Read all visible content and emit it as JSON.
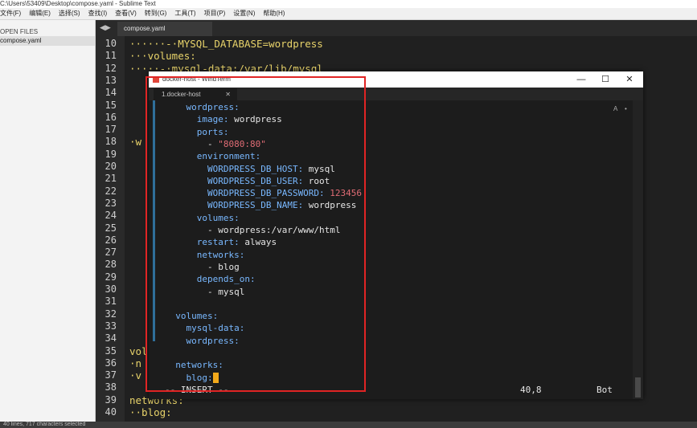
{
  "window": {
    "title": "C:\\Users\\53409\\Desktop\\compose.yaml - Sublime Text"
  },
  "menu": [
    "文件(F)",
    "编辑(E)",
    "选择(S)",
    "查找(I)",
    "查看(V)",
    "转到(G)",
    "工具(T)",
    "项目(P)",
    "设置(N)",
    "帮助(H)"
  ],
  "sidebar": {
    "header": "OPEN FILES",
    "files": [
      "compose.yaml"
    ]
  },
  "editor": {
    "tab": "compose.yaml",
    "line_numbers": [
      "10",
      "11",
      "12",
      "13",
      "14",
      "15",
      "16",
      "17",
      "18",
      "19",
      "20",
      "21",
      "22",
      "23",
      "24",
      "25",
      "26",
      "27",
      "28",
      "29",
      "30",
      "31",
      "32",
      "33",
      "34",
      "35",
      "36",
      "37",
      "38",
      "39",
      "40"
    ],
    "lines": [
      "······-·MYSQL_DATABASE=wordpress",
      "···volumes:",
      "·····-·mysql-data:/var/lib/mysql",
      "",
      "",
      "",
      "",
      "",
      "·w",
      "",
      "",
      "",
      "",
      "",
      "",
      "",
      "",
      "",
      "",
      "",
      "",
      "",
      "",
      "",
      "",
      "vol",
      "·n",
      "·v",
      "",
      "networks:",
      "··blog:"
    ],
    "status": "40 lines, 717 characters selected"
  },
  "windterm": {
    "title": "docker-host - WindTerm",
    "tab": "1.docker-host",
    "tab_close": "✕",
    "tab_right": [
      "A",
      "•",
      "⋮"
    ],
    "buttons": {
      "minimize": "—",
      "maximize": "☐",
      "close": "✕"
    },
    "lines": [
      [
        {
          "t": "    wordpress:",
          "c": "k"
        }
      ],
      [
        {
          "t": "      image:",
          "c": "k"
        },
        {
          "t": " wordpress",
          "c": "v"
        }
      ],
      [
        {
          "t": "      ports:",
          "c": "k"
        }
      ],
      [
        {
          "t": "        - ",
          "c": "v"
        },
        {
          "t": "\"8080:80\"",
          "c": "s"
        }
      ],
      [
        {
          "t": "      environment:",
          "c": "k"
        }
      ],
      [
        {
          "t": "        WORDPRESS_DB_HOST:",
          "c": "k"
        },
        {
          "t": " mysql",
          "c": "v"
        }
      ],
      [
        {
          "t": "        WORDPRESS_DB_USER:",
          "c": "k"
        },
        {
          "t": " root",
          "c": "v"
        }
      ],
      [
        {
          "t": "        WORDPRESS_DB_PASSWORD:",
          "c": "k"
        },
        {
          "t": " 123456",
          "c": "n"
        }
      ],
      [
        {
          "t": "        WORDPRESS_DB_NAME:",
          "c": "k"
        },
        {
          "t": " wordpress",
          "c": "v"
        }
      ],
      [
        {
          "t": "      volumes:",
          "c": "k"
        }
      ],
      [
        {
          "t": "        - wordpress:/var/www/html",
          "c": "v"
        }
      ],
      [
        {
          "t": "      restart:",
          "c": "k"
        },
        {
          "t": " always",
          "c": "v"
        }
      ],
      [
        {
          "t": "      networks:",
          "c": "k"
        }
      ],
      [
        {
          "t": "        - blog",
          "c": "v"
        }
      ],
      [
        {
          "t": "      depends_on:",
          "c": "k"
        }
      ],
      [
        {
          "t": "        - mysql",
          "c": "v"
        }
      ],
      [
        {
          "t": "",
          "c": "v"
        }
      ],
      [
        {
          "t": "  volumes:",
          "c": "k"
        }
      ],
      [
        {
          "t": "    mysql-data:",
          "c": "k"
        }
      ],
      [
        {
          "t": "    wordpress:",
          "c": "k"
        }
      ],
      [
        {
          "t": "",
          "c": "v"
        }
      ],
      [
        {
          "t": "  networks:",
          "c": "k"
        }
      ],
      [
        {
          "t": "    blog:",
          "c": "k"
        }
      ]
    ],
    "mode": "-- INSERT --",
    "position": "40,8",
    "scroll": "Bot"
  },
  "colors": {
    "key": "#79b8ff",
    "value": "#e6e6e6",
    "string": "#e06c75",
    "highlight_box": "#e02424",
    "cursor": "#f2a91b"
  }
}
